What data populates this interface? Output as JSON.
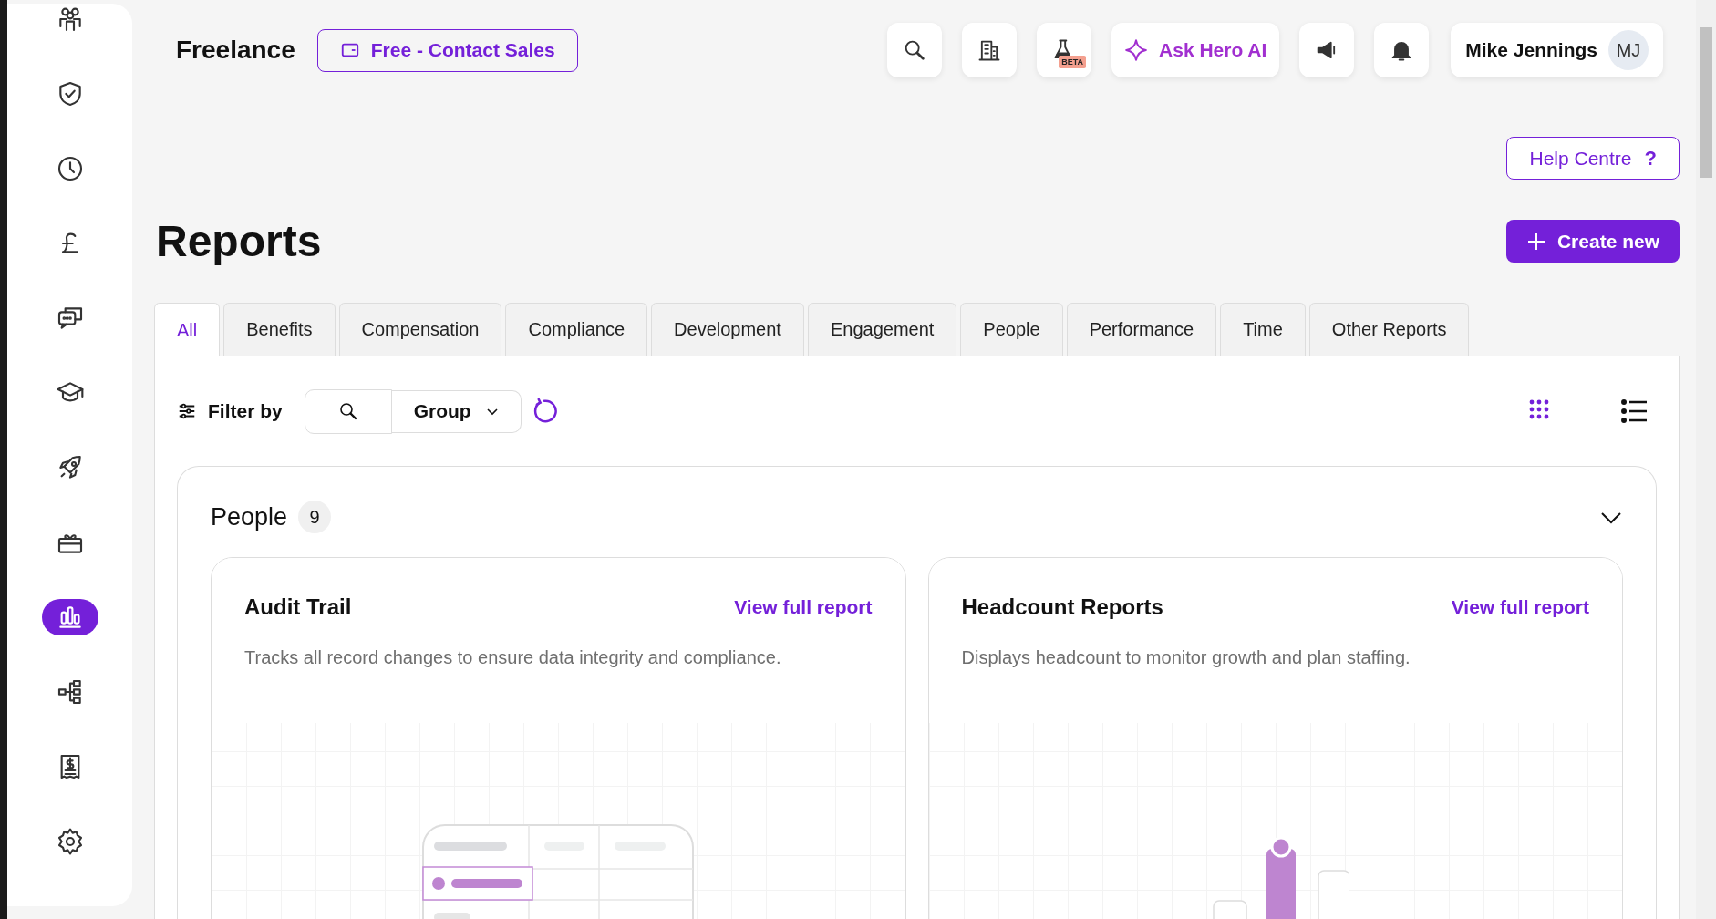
{
  "sidebar": {
    "items": [
      {
        "kind": "people",
        "selected": false
      },
      {
        "kind": "shield",
        "selected": false
      },
      {
        "kind": "clock",
        "selected": false
      },
      {
        "kind": "pound",
        "selected": false
      },
      {
        "kind": "chat",
        "selected": false
      },
      {
        "kind": "graduation",
        "selected": false
      },
      {
        "kind": "rocket",
        "selected": false
      },
      {
        "kind": "gift",
        "selected": false
      },
      {
        "kind": "chart",
        "selected": true
      },
      {
        "kind": "org",
        "selected": false
      },
      {
        "kind": "receipt",
        "selected": false
      },
      {
        "kind": "settings",
        "selected": false
      }
    ]
  },
  "header": {
    "company": "Freelance",
    "plan_button": "Free - Contact Sales",
    "actions": [
      {
        "kind": "search"
      },
      {
        "kind": "building"
      },
      {
        "kind": "beta",
        "badge": "BETA"
      },
      {
        "kind": "ai",
        "label": "Ask Hero AI"
      },
      {
        "kind": "megaphone"
      },
      {
        "kind": "bell"
      }
    ],
    "user": {
      "name": "Mike Jennings",
      "initials": "MJ"
    }
  },
  "help_button": "Help Centre",
  "help_icon": "?",
  "page_title": "Reports",
  "create_button": "Create new",
  "tabs": [
    {
      "label": "All",
      "selected": true
    },
    {
      "label": "Benefits",
      "selected": false
    },
    {
      "label": "Compensation",
      "selected": false
    },
    {
      "label": "Compliance",
      "selected": false
    },
    {
      "label": "Development",
      "selected": false
    },
    {
      "label": "Engagement",
      "selected": false
    },
    {
      "label": "People",
      "selected": false
    },
    {
      "label": "Performance",
      "selected": false
    },
    {
      "label": "Time",
      "selected": false
    },
    {
      "label": "Other Reports",
      "selected": false
    }
  ],
  "filter": {
    "label": "Filter by",
    "group_dropdown": "Group",
    "views": [
      {
        "kind": "grid",
        "selected": true
      },
      {
        "kind": "list",
        "selected": false
      }
    ]
  },
  "group": {
    "title": "People",
    "count": "9",
    "expanded": true,
    "cards": [
      {
        "title": "Audit Trail",
        "link": "View full report",
        "description": "Tracks all record changes to ensure data integrity and compliance.",
        "kind": "table"
      },
      {
        "title": "Headcount Reports",
        "link": "View full report",
        "description": "Displays headcount to monitor growth and plan staffing.",
        "kind": "bars"
      }
    ]
  }
}
